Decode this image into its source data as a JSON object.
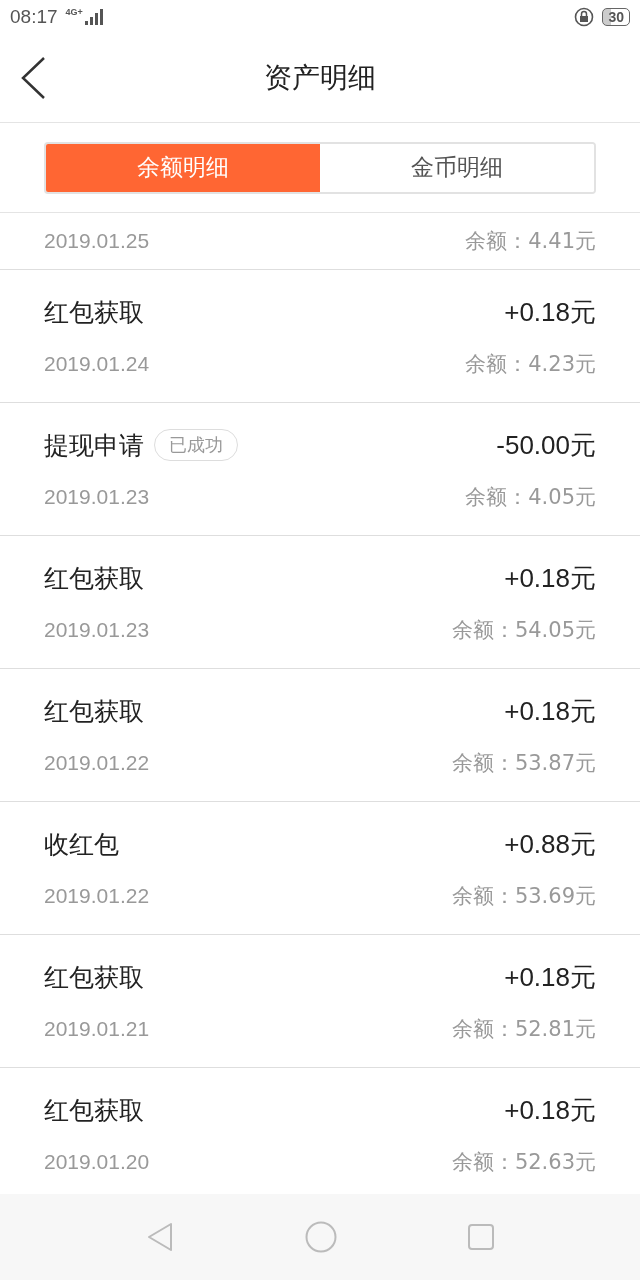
{
  "status_bar": {
    "time": "08:17",
    "network": "4G+",
    "battery": "30"
  },
  "header": {
    "title": "资产明细"
  },
  "tabs": [
    {
      "label": "余额明细",
      "selected": true
    },
    {
      "label": "金币明细",
      "selected": false
    }
  ],
  "records": [
    {
      "date": "2019.01.25",
      "balance": "余额：4.41元"
    },
    {
      "title": "红包获取",
      "amount": "+0.18元",
      "date": "2019.01.24",
      "balance": "余额：4.23元"
    },
    {
      "title": "提现申请",
      "badge": "已成功",
      "amount": "-50.00元",
      "date": "2019.01.23",
      "balance": "余额：4.05元"
    },
    {
      "title": "红包获取",
      "amount": "+0.18元",
      "date": "2019.01.23",
      "balance": "余额：54.05元"
    },
    {
      "title": "红包获取",
      "amount": "+0.18元",
      "date": "2019.01.22",
      "balance": "余额：53.87元"
    },
    {
      "title": "收红包",
      "amount": "+0.88元",
      "date": "2019.01.22",
      "balance": "余额：53.69元"
    },
    {
      "title": "红包获取",
      "amount": "+0.18元",
      "date": "2019.01.21",
      "balance": "余额：52.81元"
    },
    {
      "title": "红包获取",
      "amount": "+0.18元",
      "date": "2019.01.20",
      "balance": "余额：52.63元"
    }
  ]
}
